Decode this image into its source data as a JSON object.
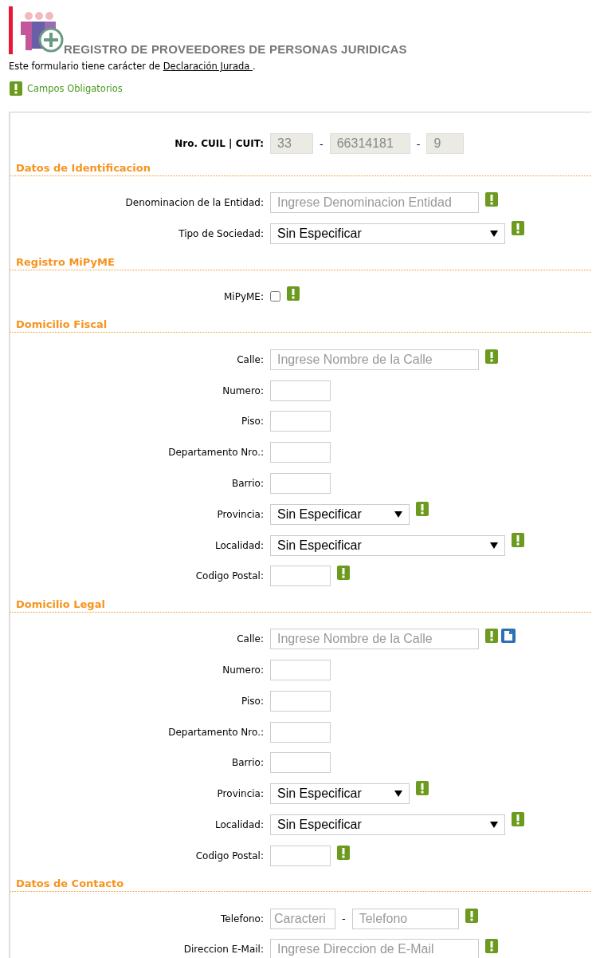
{
  "header": {
    "title": "REGISTRO DE PROVEEDORES DE PERSONAS JURIDICAS"
  },
  "notice": {
    "text": "Este formulario tiene carácter de ",
    "link": "Declaración Jurada ",
    "suffix": "."
  },
  "legend": {
    "text": "Campos Obligatorios"
  },
  "cuit": {
    "label": "Nro. CUIL | CUIT:",
    "separator": "-",
    "parts": [
      "33",
      "66314181",
      "9"
    ]
  },
  "sections": [
    {
      "title": "Datos de Identificacion",
      "fields": [
        {
          "label": "Denominacion de la Entidad:",
          "kind": "text",
          "placeholder": "Ingrese Denominacion Entidad",
          "required": true
        },
        {
          "label": "Tipo de Sociedad:",
          "kind": "select",
          "value": "Sin Especificar",
          "required": true
        }
      ]
    },
    {
      "title": "Registro MiPyME",
      "fields": [
        {
          "label": "MiPyME:",
          "kind": "checkbox",
          "checked": false,
          "required": true
        }
      ]
    },
    {
      "title": "Domicilio Fiscal",
      "fields": [
        {
          "label": "Calle:",
          "kind": "text",
          "placeholder": "Ingrese Nombre de la Calle",
          "required": true
        },
        {
          "label": "Numero:",
          "kind": "small",
          "required": false
        },
        {
          "label": "Piso:",
          "kind": "small",
          "required": false
        },
        {
          "label": "Departamento Nro.:",
          "kind": "small",
          "required": false
        },
        {
          "label": "Barrio:",
          "kind": "small",
          "required": false
        },
        {
          "label": "Provincia:",
          "kind": "short-select",
          "value": "Sin Especificar",
          "required": true
        },
        {
          "label": "Localidad:",
          "kind": "select",
          "value": "Sin Especificar",
          "required": true
        },
        {
          "label": "Codigo Postal:",
          "kind": "small",
          "required": true
        }
      ]
    },
    {
      "title": "Domicilio Legal",
      "fields": [
        {
          "label": "Calle:",
          "kind": "text",
          "placeholder": "Ingrese Nombre de la Calle",
          "required": true,
          "copy": true
        },
        {
          "label": "Numero:",
          "kind": "small",
          "required": false
        },
        {
          "label": "Piso:",
          "kind": "small",
          "required": false
        },
        {
          "label": "Departamento Nro.:",
          "kind": "small",
          "required": false
        },
        {
          "label": "Barrio:",
          "kind": "small",
          "required": false
        },
        {
          "label": "Provincia:",
          "kind": "short-select",
          "value": "Sin Especificar",
          "required": true
        },
        {
          "label": "Localidad:",
          "kind": "select",
          "value": "Sin Especificar",
          "required": true
        },
        {
          "label": "Codigo Postal:",
          "kind": "small",
          "required": true
        }
      ]
    },
    {
      "title": "Datos de Contacto",
      "fields": [
        {
          "label": "Telefono:",
          "kind": "phone",
          "placeholders": [
            "Caracteri",
            "Telefono"
          ],
          "separator": "-",
          "required": true
        },
        {
          "label": "Direccion E-Mail:",
          "kind": "text",
          "placeholder": "Ingrese Direccion de E-Mail",
          "required": true
        }
      ]
    }
  ]
}
